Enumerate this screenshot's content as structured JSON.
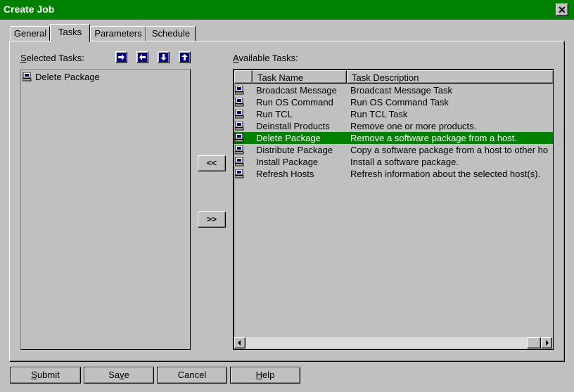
{
  "window": {
    "title": "Create Job",
    "close_label": "✕"
  },
  "tabs": [
    {
      "label": "General",
      "active": false
    },
    {
      "label": "Tasks",
      "active": true
    },
    {
      "label": "Parameters",
      "active": false
    },
    {
      "label": "Schedule",
      "active": false
    }
  ],
  "selected_tasks": {
    "label_prefix": "S",
    "label_rest": "elected Tasks:",
    "items": [
      "Delete Package"
    ],
    "arrow_buttons": [
      "arrow-right-icon",
      "arrow-left-icon",
      "arrow-down-icon",
      "arrow-up-icon"
    ]
  },
  "move_buttons": {
    "add_label": "<<",
    "remove_label": ">>"
  },
  "available_tasks": {
    "label_prefix": "A",
    "label_rest": "vailable Tasks:",
    "columns": [
      "Task Name",
      "Task Description"
    ],
    "rows": [
      {
        "name": "Broadcast Message",
        "description": "Broadcast Message Task"
      },
      {
        "name": "Run OS Command",
        "description": "Run OS Command Task"
      },
      {
        "name": "Run TCL",
        "description": "Run TCL Task"
      },
      {
        "name": "Deinstall Products",
        "description": "Remove one or more products."
      },
      {
        "name": "Delete Package",
        "description": "Remove a software package from a host.",
        "selected": true
      },
      {
        "name": "Distribute Package",
        "description": "Copy a software package from a host to other ho"
      },
      {
        "name": "Install Package",
        "description": "Install a software package."
      },
      {
        "name": "Refresh Hosts",
        "description": "Refresh information about the selected host(s)."
      }
    ]
  },
  "buttons": {
    "submit": {
      "prefix": "S",
      "rest": "ubmit"
    },
    "save": {
      "prefix": "Sa",
      "u": "v",
      "rest": "e"
    },
    "cancel": "Cancel",
    "help": {
      "u": "H",
      "rest": "elp"
    }
  },
  "colors": {
    "accent": "#008000",
    "face": "#c0c0c0"
  }
}
